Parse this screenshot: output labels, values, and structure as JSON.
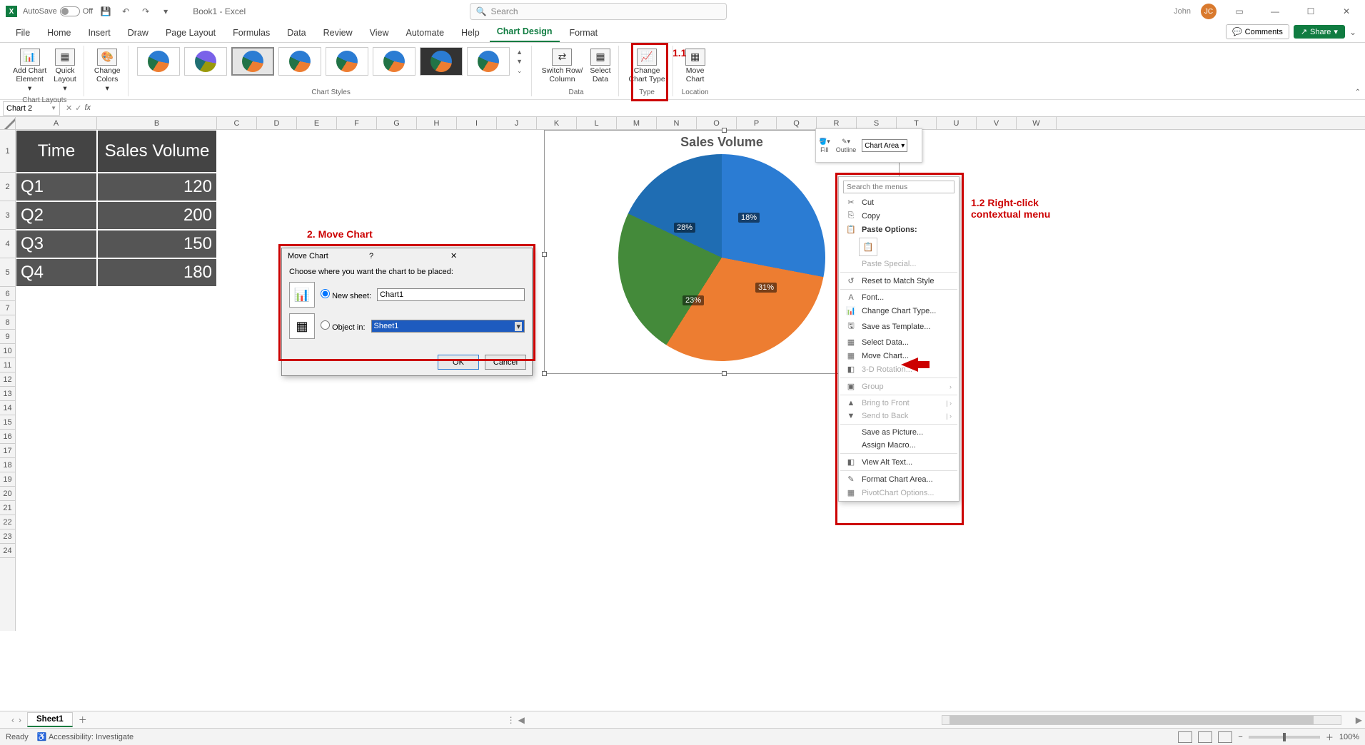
{
  "titlebar": {
    "autosave_label": "AutoSave",
    "autosave_state": "Off",
    "doc": "Book1 - Excel",
    "search_placeholder": "Search",
    "user_name": "John",
    "user_initials": "JC"
  },
  "tabs": [
    "File",
    "Home",
    "Insert",
    "Draw",
    "Page Layout",
    "Formulas",
    "Data",
    "Review",
    "View",
    "Automate",
    "Help",
    "Chart Design",
    "Format"
  ],
  "active_tab": "Chart Design",
  "tabs_right": {
    "comments": "Comments",
    "share": "Share"
  },
  "ribbon": {
    "add_element": "Add Chart\nElement",
    "quick_layout": "Quick\nLayout",
    "change_colors": "Change\nColors",
    "switch_rc": "Switch Row/\nColumn",
    "select_data": "Select\nData",
    "change_type": "Change\nChart Type",
    "move_chart": "Move\nChart",
    "group_layouts": "Chart Layouts",
    "group_styles": "Chart Styles",
    "group_data": "Data",
    "group_type": "Type",
    "group_location": "Location"
  },
  "name_box": "Chart 2",
  "columns": [
    "A",
    "B",
    "C",
    "D",
    "E",
    "F",
    "G",
    "H",
    "I",
    "J",
    "K",
    "L",
    "M",
    "N",
    "O",
    "P",
    "Q",
    "R",
    "S",
    "T",
    "U",
    "V",
    "W"
  ],
  "row_count": 24,
  "table": {
    "headers": [
      "Time",
      "Sales Volume"
    ],
    "rows": [
      [
        "Q1",
        "120"
      ],
      [
        "Q2",
        "200"
      ],
      [
        "Q3",
        "150"
      ],
      [
        "Q4",
        "180"
      ]
    ]
  },
  "chart_data": {
    "type": "pie",
    "title": "Sales Volume",
    "categories": [
      "Q1",
      "Q2",
      "Q3",
      "Q4"
    ],
    "values": [
      120,
      200,
      150,
      180
    ],
    "labels_pct": [
      "18%",
      "31%",
      "23%",
      "28%"
    ],
    "colors": [
      "#1f6db3",
      "#ed7d31",
      "#448a3a",
      "#2b7cd3"
    ]
  },
  "dialog": {
    "title": "Move Chart",
    "prompt": "Choose where you want the chart to be placed:",
    "new_sheet_label": "New sheet:",
    "new_sheet_value": "Chart1",
    "object_in_label": "Object in:",
    "object_in_value": "Sheet1",
    "ok": "OK",
    "cancel": "Cancel"
  },
  "mini_tb": {
    "fill": "Fill",
    "outline": "Outline",
    "select_value": "Chart Area"
  },
  "context_menu": {
    "search_placeholder": "Search the menus",
    "cut": "Cut",
    "copy": "Copy",
    "paste_options": "Paste Options:",
    "paste_special": "Paste Special...",
    "reset": "Reset to Match Style",
    "font": "Font...",
    "change_type": "Change Chart Type...",
    "save_template": "Save as Template...",
    "select_data": "Select Data...",
    "move_chart": "Move Chart...",
    "rotation": "3-D Rotation...",
    "group": "Group",
    "bring_front": "Bring to Front",
    "send_back": "Send to Back",
    "save_pic": "Save as Picture...",
    "assign_macro": "Assign Macro...",
    "alt_text": "View Alt Text...",
    "format_area": "Format Chart Area...",
    "pivot_opts": "PivotChart Options..."
  },
  "annotations": {
    "a11": "1.1",
    "a2": "2. Move Chart",
    "a12": "1.2 Right-click\ncontextual menu"
  },
  "sheets": {
    "active": "Sheet1"
  },
  "status": {
    "ready": "Ready",
    "accessibility": "Accessibility: Investigate",
    "zoom": "100%"
  }
}
